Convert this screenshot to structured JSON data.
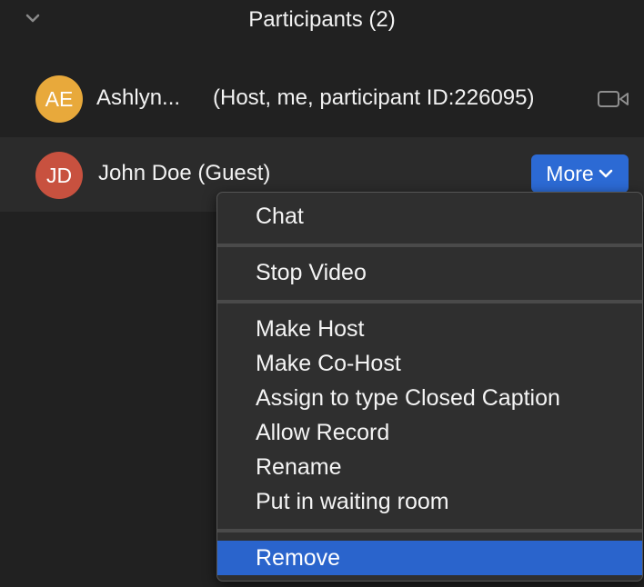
{
  "header": {
    "title": "Participants (2)",
    "collapse_icon": "chevron-down-icon"
  },
  "participants": [
    {
      "initials": "AE",
      "name": "Ashlyn...",
      "role": "(Host, me, participant ID:226095)",
      "avatar_color": "#e8a93b",
      "icon": "video-camera-icon"
    },
    {
      "initials": "JD",
      "name": "John Doe (Guest)",
      "avatar_color": "#c8513f",
      "more_label": "More"
    }
  ],
  "context_menu": {
    "groups": [
      [
        "Chat"
      ],
      [
        "Stop Video"
      ],
      [
        "Make Host",
        "Make Co-Host",
        "Assign to type Closed Caption",
        "Allow Record",
        "Rename",
        "Put in waiting room"
      ],
      [
        "Remove"
      ]
    ],
    "selected": "Remove",
    "selected_color": "#2a64cc"
  }
}
